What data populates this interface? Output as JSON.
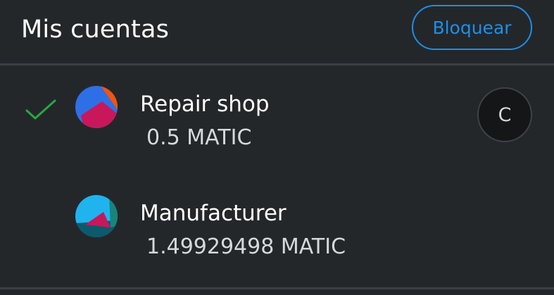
{
  "header": {
    "title": "Mis cuentas",
    "lock_label": "Bloquear"
  },
  "accounts": [
    {
      "name": "Repair shop",
      "balance": "0.5 MATIC",
      "selected": true,
      "badge": "C",
      "avatar_colors": [
        "#2f6fe6",
        "#f2540f",
        "#c9175b"
      ]
    },
    {
      "name": "Manufacturer",
      "balance": "1.49929498 MATIC",
      "selected": false,
      "avatar_colors": [
        "#1fb4ee",
        "#0c5a6c",
        "#c9175b",
        "#18857a"
      ]
    }
  ],
  "colors": {
    "background": "#24272a",
    "accent": "#1d8fe8",
    "check": "#28a745",
    "divider": "#3b3f43"
  },
  "icons": {
    "selected": "check-icon"
  }
}
